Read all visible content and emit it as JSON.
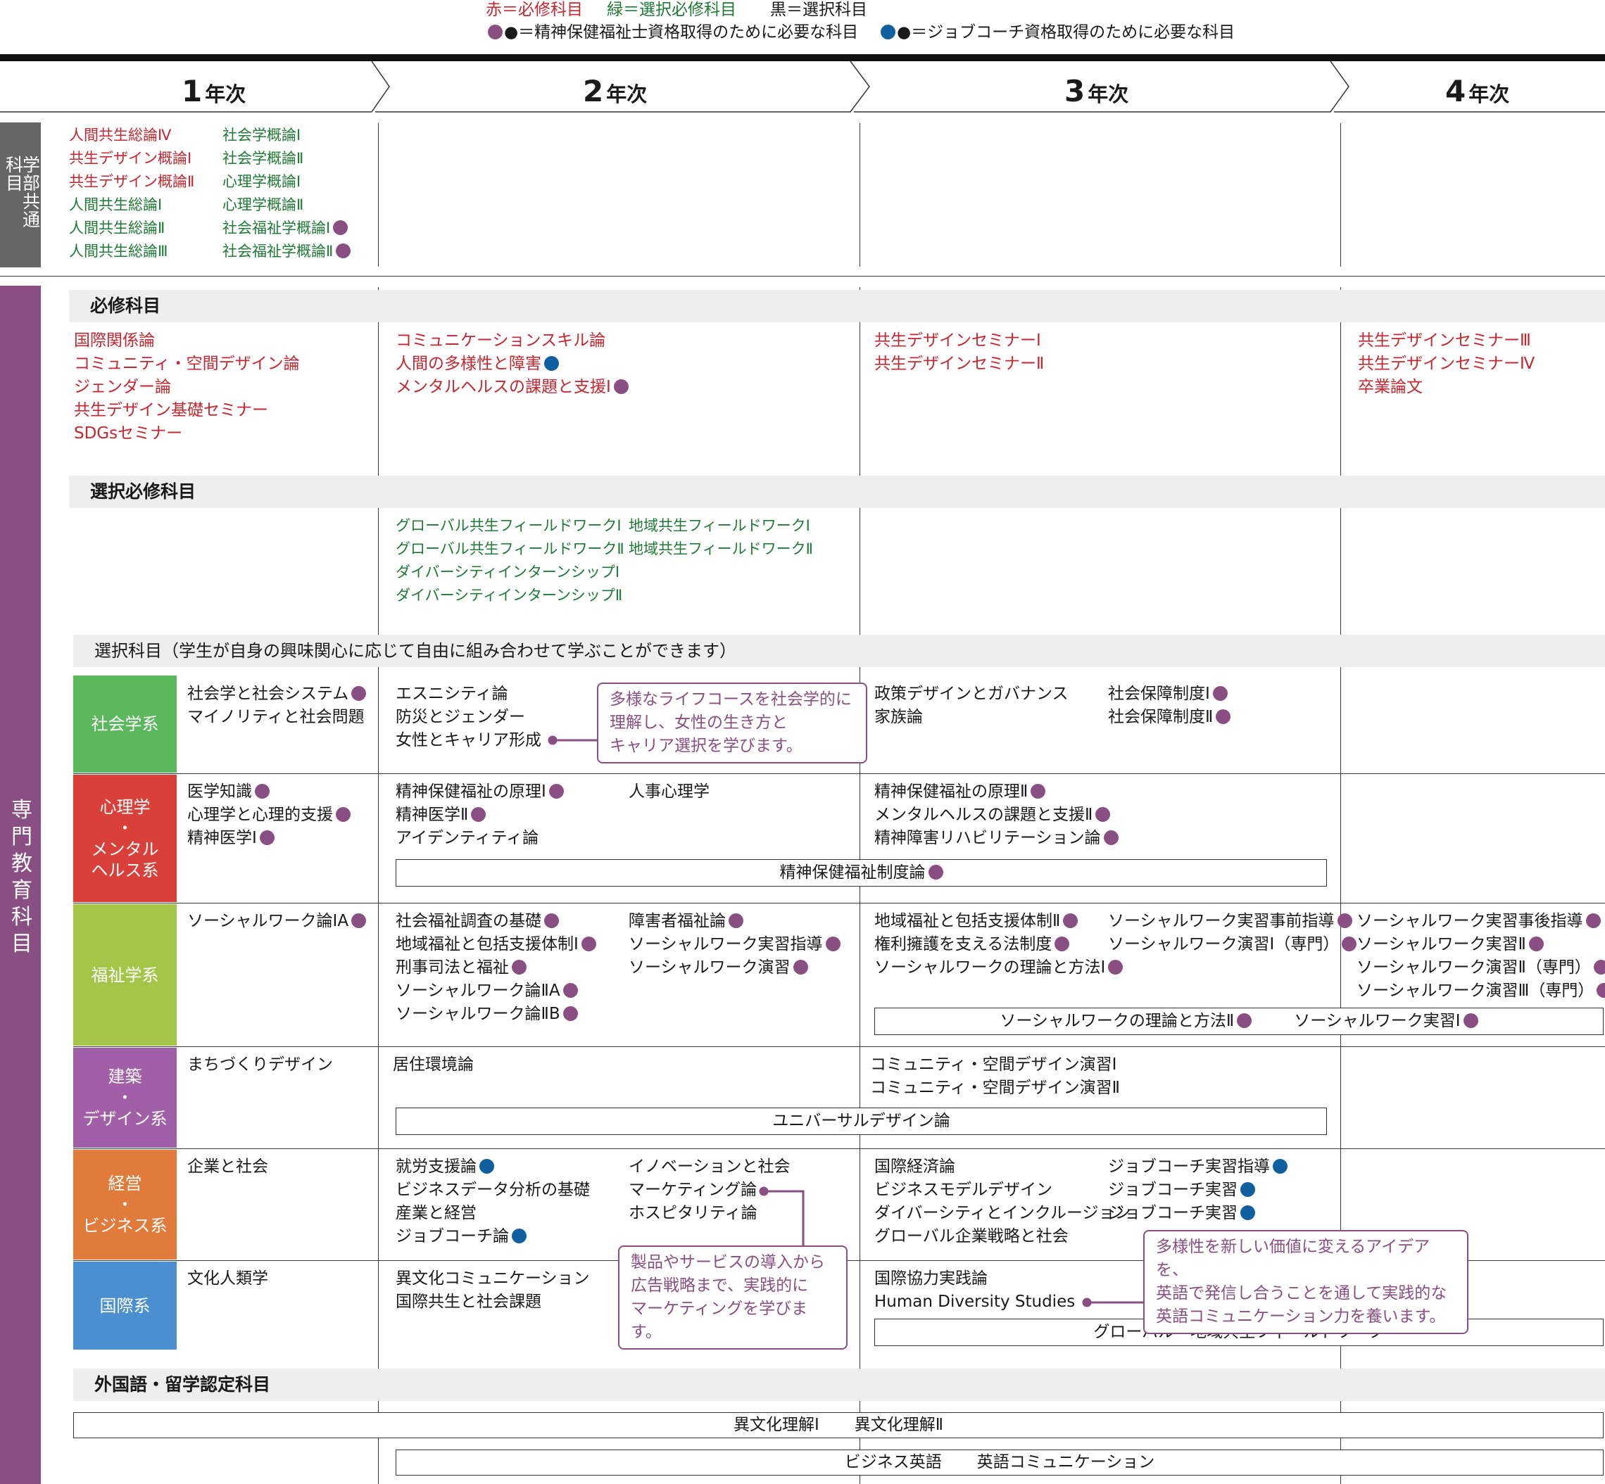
{
  "legend": {
    "required": "赤＝必修科目",
    "elective_required": "緑＝選択必修科目",
    "elective": "黒＝選択科目",
    "psw": "●＝精神保健福祉士資格取得のために必要な科目",
    "jc": "●＝ジョブコーチ資格取得のために必要な科目"
  },
  "colors": {
    "required": "#c4272f",
    "elective_required": "#1f7a35",
    "psw_dot": "#8a4f82",
    "jobcoach_dot": "#1060a0",
    "common_band": "#666666",
    "specialized_band": "#8a4f82"
  },
  "years": [
    "1",
    "2",
    "3",
    "4"
  ],
  "year_suffix": "年次",
  "common": {
    "label": "学部共通科目",
    "col1": [
      "人間共生総論Ⅳ",
      "共生デザイン概論Ⅰ",
      "共生デザイン概論Ⅱ",
      "人間共生総論Ⅰ",
      "人間共生総論Ⅱ",
      "人間共生総論Ⅲ"
    ],
    "col2": [
      "社会学概論Ⅰ",
      "社会学概論Ⅱ",
      "心理学概論Ⅰ",
      "心理学概論Ⅱ",
      "社会福祉学概論Ⅰ",
      "社会福祉学概論Ⅱ"
    ]
  },
  "specialized": {
    "label": "専門教育科目"
  },
  "required": {
    "title": "必修科目",
    "y1": [
      "国際関係論",
      "コミュニティ・空間デザイン論",
      "ジェンダー論",
      "共生デザイン基礎セミナー",
      "SDGsセミナー"
    ],
    "y2": [
      "コミュニケーションスキル論",
      "人間の多様性と障害",
      "メンタルヘルスの課題と支援Ⅰ"
    ],
    "y3": [
      "共生デザインセミナーⅠ",
      "共生デザインセミナーⅡ"
    ],
    "y4": [
      "共生デザインセミナーⅢ",
      "共生デザインセミナーⅣ",
      "卒業論文"
    ]
  },
  "elective_required": {
    "title": "選択必修科目",
    "a": [
      "グローバル共生フィールドワークⅠ",
      "グローバル共生フィールドワークⅡ",
      "ダイバーシティインターンシップⅠ",
      "ダイバーシティインターンシップⅡ"
    ],
    "b": [
      "地域共生フィールドワークⅠ",
      "地域共生フィールドワークⅡ"
    ]
  },
  "elective": {
    "title": "選択科目（学生が自身の興味関心に応じて自由に組み合わせて学ぶことができます）"
  },
  "fields": {
    "soc": {
      "label": "社会学系",
      "y1": [
        "社会学と社会システム",
        "マイノリティと社会問題"
      ],
      "y2": [
        "エスニシティ論",
        "防災とジェンダー",
        "女性とキャリア形成"
      ],
      "y3a": [
        "政策デザインとガバナンス",
        "家族論"
      ],
      "y3b": [
        "社会保障制度Ⅰ",
        "社会保障制度Ⅱ"
      ]
    },
    "psy": {
      "label": "心理学\n・\nメンタル\nヘルス系",
      "y1": [
        "医学知識",
        "心理学と心理的支援",
        "精神医学Ⅰ"
      ],
      "y2a": [
        "精神保健福祉の原理Ⅰ",
        "精神医学Ⅱ",
        "アイデンティティ論"
      ],
      "y2b": [
        "人事心理学"
      ],
      "y3": [
        "精神保健福祉の原理Ⅱ",
        "メンタルヘルスの課題と支援Ⅱ",
        "精神障害リハビリテーション論"
      ],
      "box": "精神保健福祉制度論"
    },
    "wel": {
      "label": "福祉学系",
      "y1": [
        "ソーシャルワーク論ⅠA"
      ],
      "y2a": [
        "社会福祉調査の基礎",
        "地域福祉と包括支援体制Ⅰ",
        "刑事司法と福祉",
        "ソーシャルワーク論ⅡA",
        "ソーシャルワーク論ⅡB"
      ],
      "y2b": [
        "障害者福祉論",
        "ソーシャルワーク実習指導",
        "ソーシャルワーク演習"
      ],
      "y3a": [
        "地域福祉と包括支援体制Ⅱ",
        "権利擁護を支える法制度",
        "ソーシャルワークの理論と方法Ⅰ"
      ],
      "y3b": [
        "ソーシャルワーク実習事前指導",
        "ソーシャルワーク演習Ⅰ（専門）"
      ],
      "y4": [
        "ソーシャルワーク実習事後指導",
        "ソーシャルワーク実習Ⅱ",
        "ソーシャルワーク演習Ⅱ（専門）",
        "ソーシャルワーク演習Ⅲ（専門）"
      ],
      "box1": "ソーシャルワークの理論と方法Ⅱ",
      "box2": "ソーシャルワーク実習Ⅰ"
    },
    "arc": {
      "label": "建築\n・\nデザイン系",
      "y1": [
        "まちづくりデザイン"
      ],
      "y2": [
        "居住環境論"
      ],
      "y3": [
        "コミュニティ・空間デザイン演習Ⅰ",
        "コミュニティ・空間デザイン演習Ⅱ"
      ],
      "box": "ユニバーサルデザイン論"
    },
    "biz": {
      "label": "経営\n・\nビジネス系",
      "y1": [
        "企業と社会"
      ],
      "y2a": [
        "就労支援論",
        "ビジネスデータ分析の基礎",
        "産業と経営",
        "ジョブコーチ論"
      ],
      "y2b": [
        "イノベーションと社会",
        "マーケティング論",
        "ホスピタリティ論"
      ],
      "y3a": [
        "国際経済論",
        "ビジネスモデルデザイン",
        "ダイバーシティとインクルージョン",
        "グローバル企業戦略と社会"
      ],
      "y3b": [
        "ジョブコーチ実習指導",
        "ジョブコーチ実習",
        "ジョブコーチ実習"
      ]
    },
    "intl": {
      "label": "国際系",
      "y1": [
        "文化人類学"
      ],
      "y2": [
        "異文化コミュニケーション",
        "国際共生と社会課題"
      ],
      "y3": [
        "国際協力実践論",
        "Human Diversity Studies"
      ],
      "box": "グローバル・地域共生フィールドワーク"
    }
  },
  "callouts": {
    "c1": "多様なライフコースを社会学的に\n理解し、女性の生き方と\nキャリア選択を学びます。",
    "c2": "製品やサービスの導入から\n広告戦略まで、実践的に\nマーケティングを学びます。",
    "c3": "多様性を新しい価値に変えるアイデアを、\n英語で発信し合うことを通して実践的な\n英語コミュニケーション力を養います。"
  },
  "foreign": {
    "title": "外国語・留学認定科目",
    "box1a": "異文化理解Ⅰ",
    "box1b": "異文化理解Ⅱ",
    "box2a": "ビジネス英語",
    "box2b": "英語コミュニケーション"
  }
}
